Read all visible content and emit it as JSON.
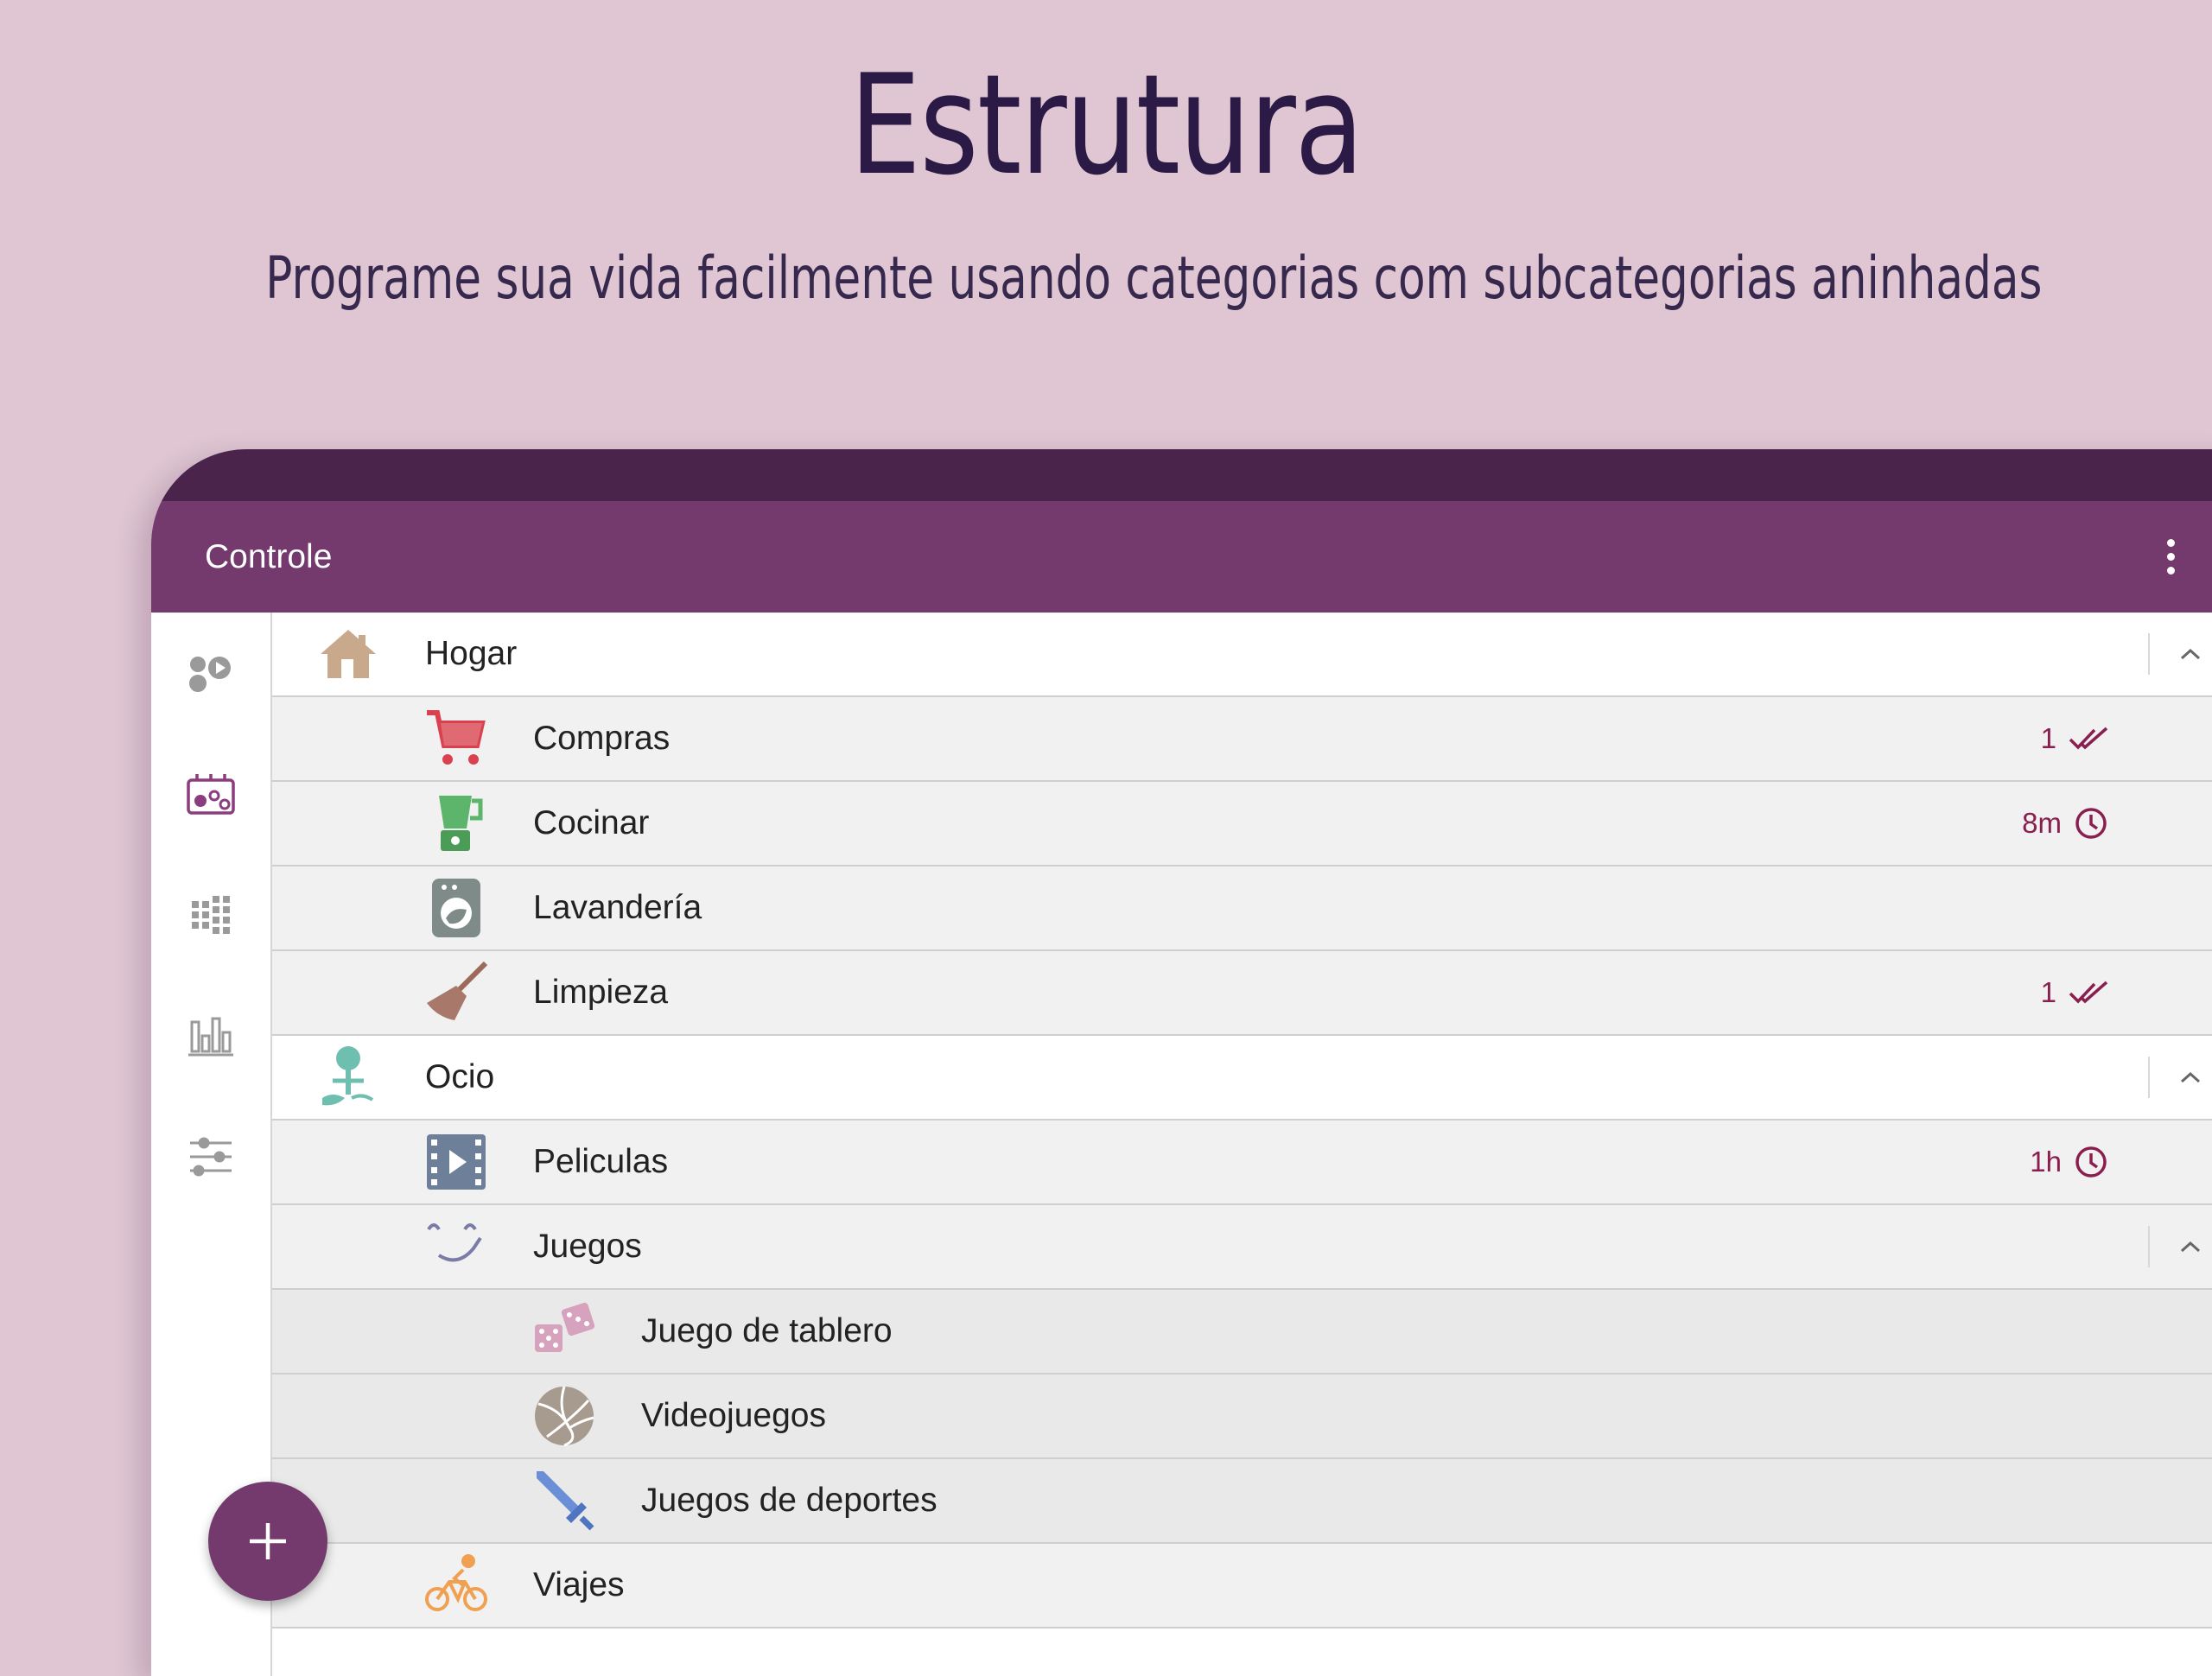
{
  "hero": {
    "title": "Estrutura",
    "subtitle": "Programe sua vida facilmente usando categorias com subcategorias aninhadas"
  },
  "app_bar": {
    "title": "Controle",
    "menu_icon": "more-vert-icon"
  },
  "rail": {
    "items": [
      {
        "icon": "activities-icon"
      },
      {
        "icon": "timeline-icon"
      },
      {
        "icon": "calendar-grid-icon"
      },
      {
        "icon": "bar-chart-icon"
      },
      {
        "icon": "filter-sliders-icon"
      }
    ]
  },
  "categories": [
    {
      "label": "Hogar",
      "icon": "house-icon",
      "level": 0,
      "expanded": true
    },
    {
      "label": "Compras",
      "icon": "shopping-cart-icon",
      "level": 1,
      "badge": "1",
      "badge_icon": "done-all-icon"
    },
    {
      "label": "Cocinar",
      "icon": "blender-icon",
      "level": 1,
      "badge": "8m",
      "badge_icon": "clock-icon"
    },
    {
      "label": "Lavandería",
      "icon": "washing-machine-icon",
      "level": 1
    },
    {
      "label": "Limpieza",
      "icon": "broom-icon",
      "level": 1,
      "badge": "1",
      "badge_icon": "done-all-icon"
    },
    {
      "label": "Ocio",
      "icon": "tree-bench-icon",
      "level": 0,
      "expanded": true
    },
    {
      "label": "Peliculas",
      "icon": "film-icon",
      "level": 1,
      "badge": "1h",
      "badge_icon": "clock-icon"
    },
    {
      "label": "Juegos",
      "icon": "smiley-icon",
      "level": 1,
      "expanded": true
    },
    {
      "label": "Juego de tablero",
      "icon": "dice-icon",
      "level": 2
    },
    {
      "label": "Videojuegos",
      "icon": "volleyball-icon",
      "level": 2
    },
    {
      "label": "Juegos de deportes",
      "icon": "sword-icon",
      "level": 2
    },
    {
      "label": "Viajes",
      "icon": "bicycle-icon",
      "level": 1
    }
  ],
  "fab": {
    "icon": "plus-icon"
  },
  "colors": {
    "background": "#dfc6d2",
    "app_bar": "#743a6d",
    "status_bar": "#4b244c",
    "badge": "#8a1f4f",
    "title": "#2b1a45"
  }
}
